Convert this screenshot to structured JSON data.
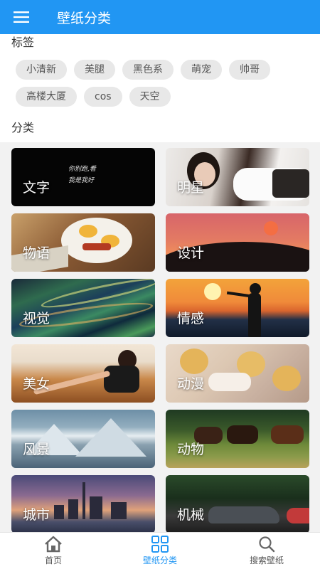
{
  "appbar": {
    "title": "壁纸分类",
    "menu_icon": "menu-icon"
  },
  "tags_section": {
    "title": "标签",
    "tags": [
      "小清新",
      "美腿",
      "黑色系",
      "萌宠",
      "帅哥",
      "高楼大厦",
      "cos",
      "天空"
    ]
  },
  "categories_section": {
    "title": "分类",
    "items": [
      {
        "label": "文字",
        "text_overlay_1": "你别跑,看",
        "text_overlay_2": "我是我好"
      },
      {
        "label": "明星"
      },
      {
        "label": "物语"
      },
      {
        "label": "设计"
      },
      {
        "label": "视觉"
      },
      {
        "label": "情感"
      },
      {
        "label": "美女"
      },
      {
        "label": "动漫"
      },
      {
        "label": "风景"
      },
      {
        "label": "动物"
      },
      {
        "label": "城市"
      },
      {
        "label": "机械"
      }
    ]
  },
  "tabbar": {
    "tabs": [
      {
        "label": "首页",
        "icon": "home-icon"
      },
      {
        "label": "壁纸分类",
        "icon": "grid-icon",
        "active": true
      },
      {
        "label": "搜索壁纸",
        "icon": "search-icon"
      }
    ]
  },
  "colors": {
    "primary": "#2196f3",
    "tag_bg": "#e8e8e8"
  }
}
